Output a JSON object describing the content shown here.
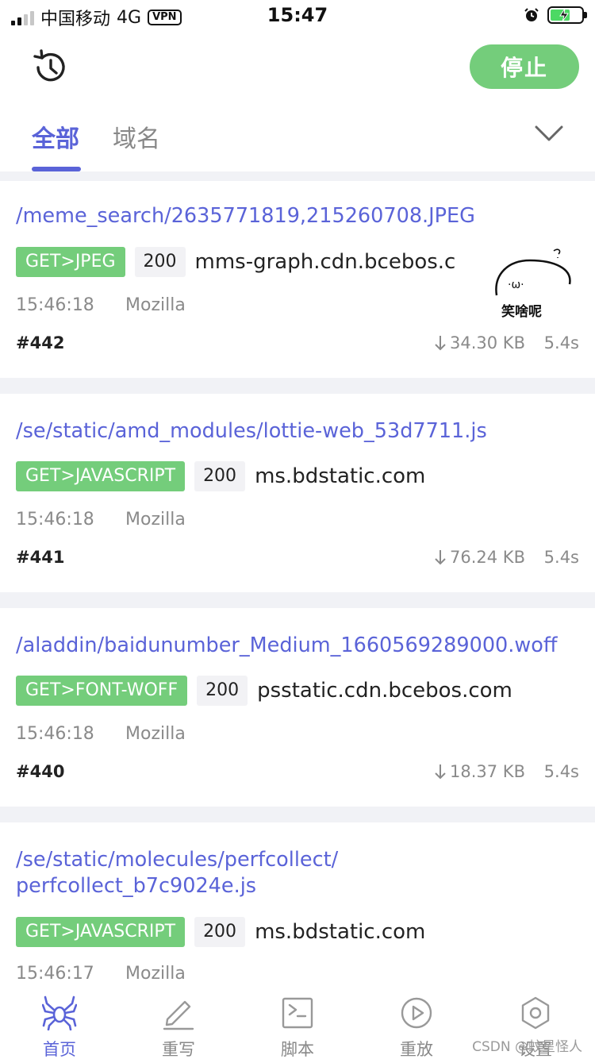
{
  "status_bar": {
    "carrier": "中国移动",
    "network": "4G",
    "vpn": "VPN",
    "time": "15:47"
  },
  "header": {
    "stop_label": "停止"
  },
  "tabs": [
    {
      "label": "全部",
      "active": true
    },
    {
      "label": "域名",
      "active": false
    }
  ],
  "requests": [
    {
      "path": "/meme_search/2635771819,215260708.JPEG",
      "method": "GET>JPEG",
      "status": "200",
      "host": "mms-graph.cdn.bcebos.c",
      "time": "15:46:18",
      "agent": "Mozilla",
      "id": "#442",
      "size": "34.30 KB",
      "duration": "5.4s"
    },
    {
      "path": "/se/static/amd_modules/lottie-web_53d7711.js",
      "method": "GET>JAVASCRIPT",
      "status": "200",
      "host": "ms.bdstatic.com",
      "time": "15:46:18",
      "agent": "Mozilla",
      "id": "#441",
      "size": "76.24 KB",
      "duration": "5.4s"
    },
    {
      "path": "/aladdin/baidunumber_Medium_1660569289000.woff",
      "method": "GET>FONT-WOFF",
      "status": "200",
      "host": "psstatic.cdn.bcebos.com",
      "time": "15:46:18",
      "agent": "Mozilla",
      "id": "#440",
      "size": "18.37 KB",
      "duration": "5.4s"
    },
    {
      "path_line1": "/se/static/molecules/perfcollect/",
      "path_line2": "perfcollect_b7c9024e.js",
      "method": "GET>JAVASCRIPT",
      "status": "200",
      "host": "ms.bdstatic.com",
      "time": "15:46:17",
      "agent": "Mozilla"
    }
  ],
  "sticker": {
    "face": "·ω·",
    "caption": "笑啥呢"
  },
  "bottom_nav": [
    {
      "label": "首页",
      "icon": "spider-icon",
      "active": true
    },
    {
      "label": "重写",
      "icon": "pen-icon",
      "active": false
    },
    {
      "label": "脚本",
      "icon": "terminal-icon",
      "active": false
    },
    {
      "label": "重放",
      "icon": "play-icon",
      "active": false
    },
    {
      "label": "设置",
      "icon": "hexagon-settings-icon",
      "active": false
    }
  ],
  "watermark": "CSDN @蚊星怪人",
  "colors": {
    "accent": "#5a63d8",
    "method_badge": "#74cd7b",
    "stop_button": "#74cd7b",
    "divider": "#f1f2f6"
  }
}
